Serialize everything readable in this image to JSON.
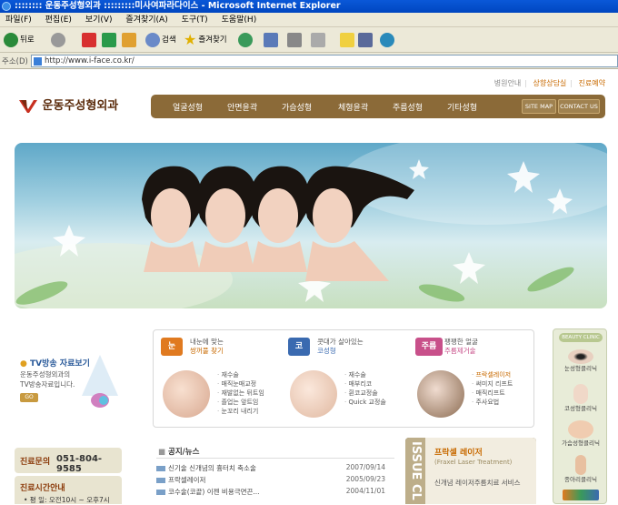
{
  "window": {
    "title": ":::::::: 운동주성형외과 :::::::::미사여파라다이스 - Microsoft Internet Explorer"
  },
  "menu": [
    "파일(F)",
    "편집(E)",
    "보기(V)",
    "즐겨찾기(A)",
    "도구(T)",
    "도움말(H)"
  ],
  "toolbar": {
    "back": "뒤로",
    "search": "검색",
    "favorites": "즐겨찾기"
  },
  "address": {
    "label": "주소(D)",
    "url": "http://www.i-face.co.kr/"
  },
  "site": {
    "toplinks": [
      "병원안내",
      "상향상담실",
      "진료예약"
    ],
    "logo": "운동주성형외과",
    "nav": [
      "얼굴성형",
      "안면윤곽",
      "가슴성형",
      "체형윤곽",
      "주름성형",
      "기타성형"
    ],
    "sitemap": "SITE MAP",
    "contact": "CONTACT US"
  },
  "tv": {
    "title": "TV방송 자료보기",
    "line1": "운동주성형외과의",
    "line2": "TV방송자료입니다.",
    "go": "GO"
  },
  "call": {
    "label": "진료문의",
    "phone": "051-804-9585"
  },
  "hours": {
    "label": "진료시간안내",
    "line": "• 평    일: 오전10시 ~ 오후7시"
  },
  "categories": [
    {
      "badge": "눈",
      "line1": "내눈에 맞는",
      "line2": "쌍꺼풀 찾기",
      "items": [
        "재수술",
        "매직눈매교정",
        "재발없는 뒤트임",
        "졸업는 앞트임",
        "눈꼬리 내리기"
      ]
    },
    {
      "badge": "코",
      "line1": "콧대가 살아있는",
      "line2": "코성형",
      "items": [
        "재수술",
        "매부리코",
        "휜코교정술",
        "Quick 교정술"
      ]
    },
    {
      "badge": "주름",
      "line1": "팽팽한 얼굴",
      "line2": "주름제거술",
      "items": [
        "프락셀레이저",
        "써미지 리프트",
        "매직리프트",
        "주사요법"
      ]
    }
  ],
  "notice": {
    "title": "공지/뉴스",
    "rows": [
      {
        "text": "신기술 신개념의 흉터치 축소술",
        "date": "2007/09/14"
      },
      {
        "text": "프락셀레이저",
        "date": "2005/09/23"
      },
      {
        "text": "코수술(코끝) 이젠 비용극면끈...",
        "date": "2004/11/01"
      }
    ]
  },
  "issue": {
    "side": "ISSUE CL",
    "title": "프락셀 레이저",
    "subtitle": "(Fraxel Laser Treatment)",
    "desc": "신개념 레이저주름치료 서비스"
  },
  "beauty": {
    "header": "BEAUTY CLINIC",
    "items": [
      "눈성형클리닉",
      "코성형클리닉",
      "가슴성형클리닉",
      "종아리클리닉"
    ]
  },
  "colors": {
    "nav_bg": "#8b6a38",
    "accent": "#c86a00",
    "eye_badge": "#e07a20",
    "nose_badge": "#3a6ab0",
    "wrinkle_badge": "#c8508a"
  }
}
